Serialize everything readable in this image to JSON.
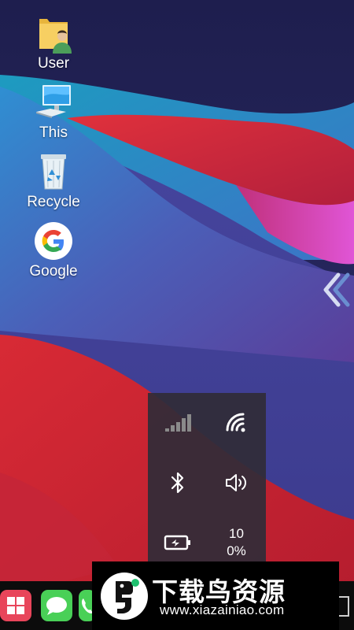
{
  "desktop": {
    "icons": [
      {
        "label": "User",
        "icon": "user-folder-icon"
      },
      {
        "label": "This",
        "icon": "computer-icon"
      },
      {
        "label": "Recycle",
        "icon": "recycle-bin-icon"
      },
      {
        "label": "Google",
        "icon": "google-icon"
      }
    ]
  },
  "quick_settings": {
    "signal_icon": "cell-signal-icon",
    "wifi_icon": "wifi-icon",
    "bluetooth_icon": "bluetooth-icon",
    "volume_icon": "volume-icon",
    "battery_icon": "battery-charging-icon",
    "battery_text": "100%"
  },
  "taskbar": {
    "apps": [
      "windows-start-icon",
      "messages-icon",
      "phone-icon"
    ]
  },
  "watermark": {
    "title": "下载鸟资源",
    "url": "www.xiazainiao.com"
  },
  "colors": {
    "wallpaper_red": "#d22b3a",
    "wallpaper_blue": "#3b7fd0",
    "wallpaper_navy": "#262462",
    "panel_bg": "#302c38",
    "taskbar_bg": "#0c0c0c"
  }
}
